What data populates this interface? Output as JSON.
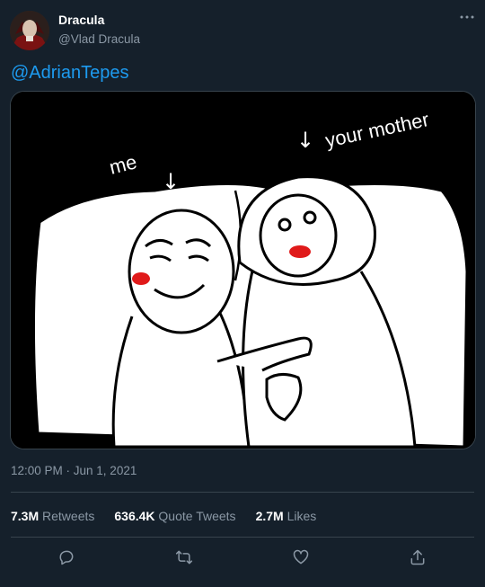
{
  "author": {
    "display_name": "Dracula",
    "handle": "@Vlad Dracula"
  },
  "tweet": {
    "mention": "@AdrianTepes",
    "image_text": {
      "me": "me",
      "your_mother": "your mother",
      "arrow_glyph": "↓"
    },
    "timestamp": "12:00 PM · Jun 1, 2021"
  },
  "stats": {
    "retweets_count": "7.3M",
    "retweets_label": "Retweets",
    "quotes_count": "636.4K",
    "quotes_label": "Quote Tweets",
    "likes_count": "2.7M",
    "likes_label": "Likes"
  },
  "icons": {
    "more": "more-horizontal-icon",
    "reply": "reply-icon",
    "retweet": "retweet-icon",
    "like": "heart-icon",
    "share": "share-icon"
  },
  "colors": {
    "background": "#15202b",
    "accent": "#1d9bf0",
    "muted": "#8b98a5",
    "border": "#38444d"
  }
}
